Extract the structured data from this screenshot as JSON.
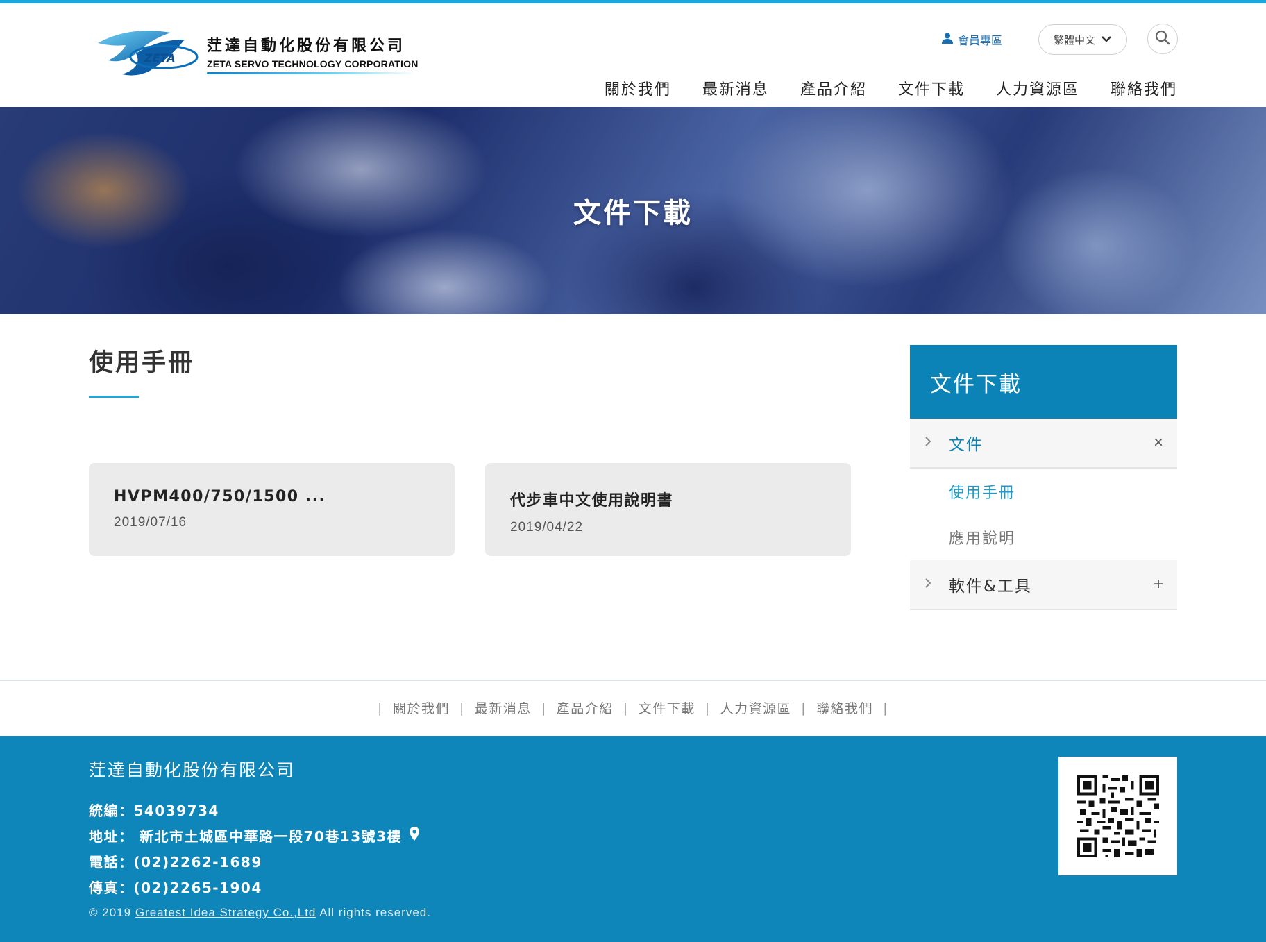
{
  "colors": {
    "accent": "#1aa8dc",
    "brand_blue": "#0b83b7",
    "footer_bg": "#0f86b9",
    "card_bg": "#ebebeb"
  },
  "header": {
    "logo_cn": "茳達自動化股份有限公司",
    "logo_en": "ZETA SERVO TECHNOLOGY CORPORATION",
    "logo_mark_text": "ZETA",
    "member_label": "會員專區",
    "language": "繁體中文",
    "nav": [
      "關於我們",
      "最新消息",
      "產品介紹",
      "文件下載",
      "人力資源區",
      "聯絡我們"
    ]
  },
  "banner": {
    "title": "文件下載"
  },
  "main": {
    "section_title": "使用手冊",
    "cards": [
      {
        "title": "HVPM400/750/1500 ...",
        "date": "2019/07/16"
      },
      {
        "title": "代步車中文使用說明書",
        "date": "2019/04/22"
      }
    ]
  },
  "sidebar": {
    "title": "文件下載",
    "items": [
      {
        "label": "文件",
        "toggle": "×",
        "children": [
          "使用手冊",
          "應用說明"
        ]
      },
      {
        "label": "軟件&工具",
        "toggle": "+"
      }
    ]
  },
  "footer_nav": [
    "關於我們",
    "最新消息",
    "產品介紹",
    "文件下載",
    "人力資源區",
    "聯絡我們"
  ],
  "footer": {
    "company": "茳達自動化股份有限公司",
    "tax_id": "統編：54039734",
    "address": "地址： 新北市土城區中華路一段70巷13號3樓",
    "phone": "電話：(02)2262-1689",
    "fax": "傳真：(02)2265-1904",
    "copyright_prefix": "© 2019",
    "copyright_link": "Greatest Idea Strategy Co.,Ltd",
    "copyright_suffix": "All rights reserved."
  },
  "icons": [
    "user-icon",
    "chevron-down-icon",
    "search-icon",
    "chevron-right-icon",
    "close-icon",
    "plus-icon",
    "map-pin-icon",
    "qr-code"
  ]
}
